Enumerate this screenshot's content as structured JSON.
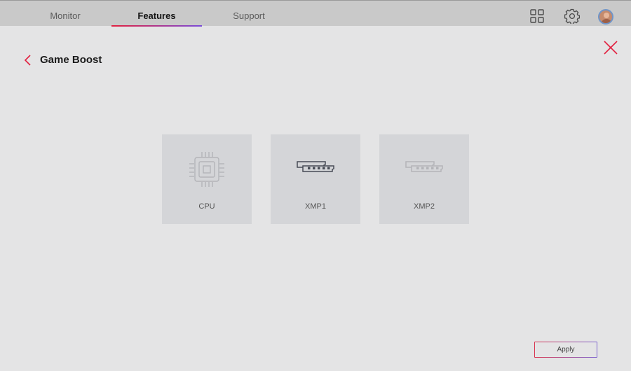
{
  "nav": {
    "tabs": [
      {
        "label": "Monitor",
        "active": false
      },
      {
        "label": "Features",
        "active": true
      },
      {
        "label": "Support",
        "active": false
      }
    ],
    "right_icons": [
      "grid-icon",
      "gear-icon",
      "avatar"
    ]
  },
  "page": {
    "title": "Game Boost",
    "back_icon": "chevron-left-icon",
    "close_icon": "close-icon"
  },
  "cards": [
    {
      "label": "CPU",
      "icon": "cpu-icon",
      "state": "disabled"
    },
    {
      "label": "XMP1",
      "icon": "memory-icon",
      "state": "enabled"
    },
    {
      "label": "XMP2",
      "icon": "memory-icon",
      "state": "disabled"
    }
  ],
  "footer": {
    "apply_label": "Apply"
  },
  "colors": {
    "accent_red": "#e2203f",
    "accent_purple": "#7a4cd9",
    "background": "#e4e4e5",
    "card": "#d4d5d8"
  }
}
